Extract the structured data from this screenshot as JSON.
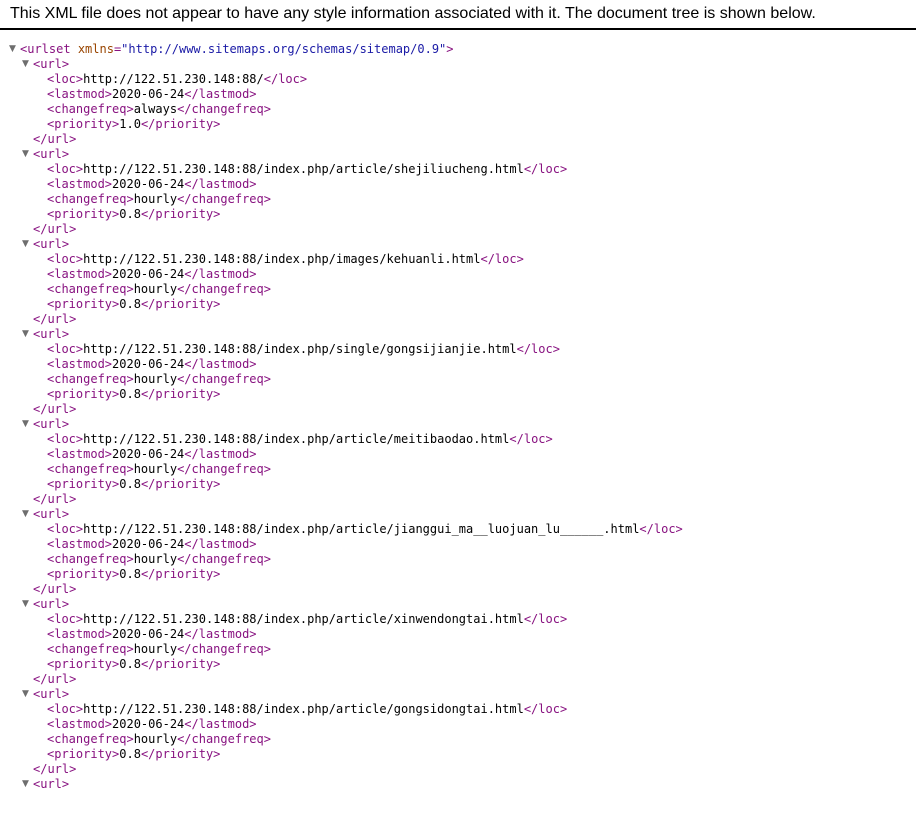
{
  "header": {
    "message": "This XML file does not appear to have any style information associated with it. The document tree is shown below."
  },
  "colors": {
    "tag": "#881280",
    "attribute_name": "#994500",
    "attribute_value": "#1a1aa6",
    "text": "#000000",
    "toggle": "#6e6e6e"
  },
  "icons": {
    "toggle": "triangle-down-icon"
  },
  "tree": {
    "toggle_glyph": "▼",
    "root_open": "<urlset",
    "root_attr_name": "xmlns",
    "root_attr_eq": "=",
    "root_attr_value": "\"http://www.sitemaps.org/schemas/sitemap/0.9\"",
    "root_open_close": ">",
    "urls": [
      {
        "open": "<url>",
        "close": "</url>",
        "loc": {
          "open": "<loc>",
          "value": "http://122.51.230.148:88/",
          "close": "</loc>"
        },
        "lastmod": {
          "open": "<lastmod>",
          "value": "2020-06-24",
          "close": "</lastmod>"
        },
        "changefreq": {
          "open": "<changefreq>",
          "value": "always",
          "close": "</changefreq>"
        },
        "priority": {
          "open": "<priority>",
          "value": "1.0",
          "close": "</priority>"
        }
      },
      {
        "open": "<url>",
        "close": "</url>",
        "loc": {
          "open": "<loc>",
          "value": "http://122.51.230.148:88/index.php/article/shejiliucheng.html",
          "close": "</loc>"
        },
        "lastmod": {
          "open": "<lastmod>",
          "value": "2020-06-24",
          "close": "</lastmod>"
        },
        "changefreq": {
          "open": "<changefreq>",
          "value": "hourly",
          "close": "</changefreq>"
        },
        "priority": {
          "open": "<priority>",
          "value": "0.8",
          "close": "</priority>"
        }
      },
      {
        "open": "<url>",
        "close": "</url>",
        "loc": {
          "open": "<loc>",
          "value": "http://122.51.230.148:88/index.php/images/kehuanli.html",
          "close": "</loc>"
        },
        "lastmod": {
          "open": "<lastmod>",
          "value": "2020-06-24",
          "close": "</lastmod>"
        },
        "changefreq": {
          "open": "<changefreq>",
          "value": "hourly",
          "close": "</changefreq>"
        },
        "priority": {
          "open": "<priority>",
          "value": "0.8",
          "close": "</priority>"
        }
      },
      {
        "open": "<url>",
        "close": "</url>",
        "loc": {
          "open": "<loc>",
          "value": "http://122.51.230.148:88/index.php/single/gongsijianjie.html",
          "close": "</loc>"
        },
        "lastmod": {
          "open": "<lastmod>",
          "value": "2020-06-24",
          "close": "</lastmod>"
        },
        "changefreq": {
          "open": "<changefreq>",
          "value": "hourly",
          "close": "</changefreq>"
        },
        "priority": {
          "open": "<priority>",
          "value": "0.8",
          "close": "</priority>"
        }
      },
      {
        "open": "<url>",
        "close": "</url>",
        "loc": {
          "open": "<loc>",
          "value": "http://122.51.230.148:88/index.php/article/meitibaodao.html",
          "close": "</loc>"
        },
        "lastmod": {
          "open": "<lastmod>",
          "value": "2020-06-24",
          "close": "</lastmod>"
        },
        "changefreq": {
          "open": "<changefreq>",
          "value": "hourly",
          "close": "</changefreq>"
        },
        "priority": {
          "open": "<priority>",
          "value": "0.8",
          "close": "</priority>"
        }
      },
      {
        "open": "<url>",
        "close": "</url>",
        "loc": {
          "open": "<loc>",
          "value": "http://122.51.230.148:88/index.php/article/jianggui_ma__luojuan_lu______.html",
          "close": "</loc>"
        },
        "lastmod": {
          "open": "<lastmod>",
          "value": "2020-06-24",
          "close": "</lastmod>"
        },
        "changefreq": {
          "open": "<changefreq>",
          "value": "hourly",
          "close": "</changefreq>"
        },
        "priority": {
          "open": "<priority>",
          "value": "0.8",
          "close": "</priority>"
        }
      },
      {
        "open": "<url>",
        "close": "</url>",
        "loc": {
          "open": "<loc>",
          "value": "http://122.51.230.148:88/index.php/article/xinwendongtai.html",
          "close": "</loc>"
        },
        "lastmod": {
          "open": "<lastmod>",
          "value": "2020-06-24",
          "close": "</lastmod>"
        },
        "changefreq": {
          "open": "<changefreq>",
          "value": "hourly",
          "close": "</changefreq>"
        },
        "priority": {
          "open": "<priority>",
          "value": "0.8",
          "close": "</priority>"
        }
      },
      {
        "open": "<url>",
        "close": "</url>",
        "loc": {
          "open": "<loc>",
          "value": "http://122.51.230.148:88/index.php/article/gongsidongtai.html",
          "close": "</loc>"
        },
        "lastmod": {
          "open": "<lastmod>",
          "value": "2020-06-24",
          "close": "</lastmod>"
        },
        "changefreq": {
          "open": "<changefreq>",
          "value": "hourly",
          "close": "</changefreq>"
        },
        "priority": {
          "open": "<priority>",
          "value": "0.8",
          "close": "</priority>"
        }
      }
    ],
    "trailing_open": "<url>"
  }
}
